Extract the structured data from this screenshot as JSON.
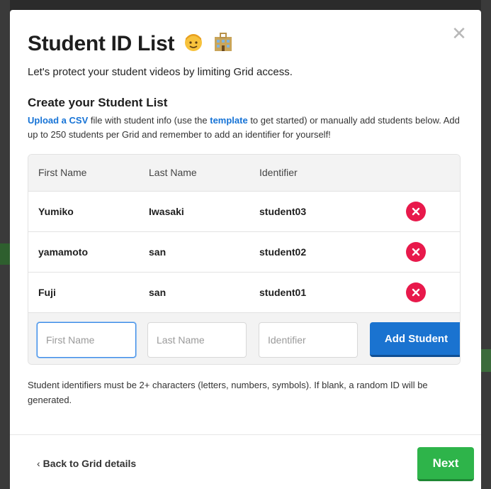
{
  "modal": {
    "title": "Student ID List",
    "title_emoji_icons": [
      "student-emoji-icon",
      "school-emoji-icon"
    ],
    "close_icon": "close-icon",
    "subtitle": "Let's protect your student videos by limiting Grid access.",
    "section_title": "Create your Student List",
    "instructions": {
      "upload_link": "Upload a CSV",
      "text_1": " file with student info (use the ",
      "template_link": "template",
      "text_2": " to get started) or manually add students below. Add up to 250 students per Grid and remember to add an identifier for yourself!"
    }
  },
  "table": {
    "headers": [
      "First Name",
      "Last Name",
      "Identifier"
    ],
    "rows": [
      {
        "first": "Yumiko",
        "last": "Iwasaki",
        "id": "student03"
      },
      {
        "first": "yamamoto",
        "last": "san",
        "id": "student02"
      },
      {
        "first": "Fuji",
        "last": "san",
        "id": "student01"
      }
    ],
    "delete_icon": "remove-circle-icon",
    "entry": {
      "first_placeholder": "First Name",
      "last_placeholder": "Last Name",
      "id_placeholder": "Identifier",
      "add_label": "Add Student"
    }
  },
  "note": "Student identifiers must be 2+ characters (letters, numbers, symbols). If blank, a random ID will be generated.",
  "footer": {
    "back_label": "Back to Grid details",
    "next_label": "Next"
  },
  "colors": {
    "link": "#1673d6",
    "primary_button": "#1a73d0",
    "next_button": "#2eb44a",
    "delete": "#e8194b"
  }
}
